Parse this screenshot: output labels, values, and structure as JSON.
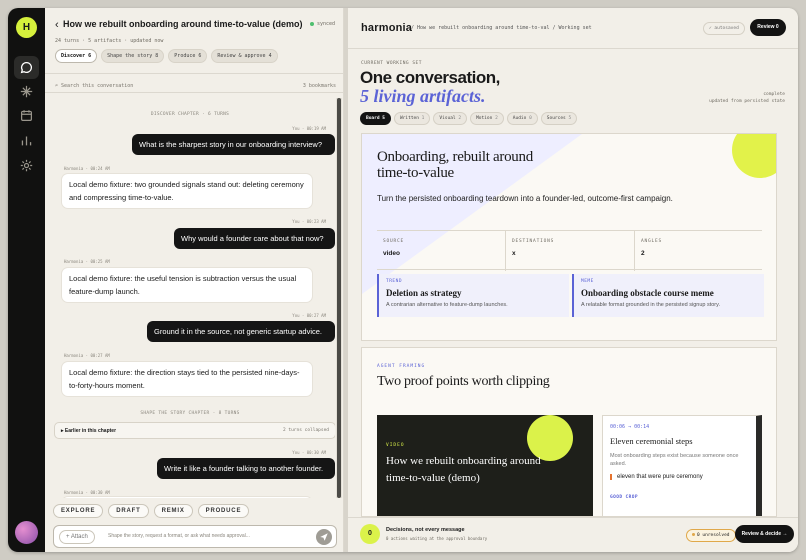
{
  "rail": {
    "logo": "H",
    "items": [
      "chat-icon",
      "sparkle-icon",
      "calendar-icon",
      "chart-icon",
      "gear-icon"
    ]
  },
  "chat": {
    "back": "‹",
    "title": "How we rebuilt onboarding around time-to-value (demo)",
    "synced": "synced",
    "meta": "24 turns · 5 artifacts · updated now",
    "chapters": [
      {
        "label": "Discover 6"
      },
      {
        "label": "Shape the story 8"
      },
      {
        "label": "Produce 6"
      },
      {
        "label": "Review & approve 4"
      }
    ],
    "search_placeholder": "Search this conversation",
    "bookmarks": "3 bookmarks",
    "divider1": "DISCOVER CHAPTER · 6 TURNS",
    "divider2": "SHAPE THE STORY CHAPTER · 8 TURNS",
    "messages": [
      {
        "role": "user",
        "stamp": "You · 00:19 AM",
        "text": "What is the sharpest story in our onboarding interview?"
      },
      {
        "role": "ai",
        "stamp": "Harmonia · 00:24 AM",
        "text": "Local demo fixture: two grounded signals stand out: deleting ceremony and compressing time-to-value."
      },
      {
        "role": "user",
        "stamp": "You · 00:23 AM",
        "text": "Why would a founder care about that now?"
      },
      {
        "role": "ai",
        "stamp": "Harmonia · 00:25 AM",
        "text": "Local demo fixture: the useful tension is subtraction versus the usual feature-dump launch."
      },
      {
        "role": "user",
        "stamp": "You · 00:27 AM",
        "text": "Ground it in the source, not generic startup advice."
      },
      {
        "role": "ai",
        "stamp": "Harmonia · 00:27 AM",
        "text": "Local demo fixture: the direction stays tied to the persisted nine-days-to-forty-hours moment."
      },
      {
        "role": "user",
        "stamp": "You · 00:30 AM",
        "text": "Write it like a founder talking to another founder."
      },
      {
        "role": "ai",
        "stamp": "Harmonia · 00:30 AM",
        "text": ""
      }
    ],
    "collapsed_label": "▸ Earlier in this chapter",
    "collapsed_count": "2 turns collapsed",
    "actions": [
      "EXPLORE",
      "DRAFT",
      "REMIX",
      "PRODUCE"
    ],
    "attach": "+ Attach",
    "composer_placeholder": "Shape the story, request a format, or ask what needs approval..."
  },
  "work": {
    "brand": "harmonia",
    "breadcrumb": "/ How we rebuilt onboarding around time-to-val / Working set",
    "autosaved": "✓ autosaved",
    "review_top": "Review 0",
    "label": "CURRENT WORKING SET",
    "heading1": "One conversation,",
    "heading2": "5 living artifacts.",
    "complete1": "complete",
    "complete2": "updated from persisted state",
    "tabs": [
      {
        "label": "Board",
        "n": "5"
      },
      {
        "label": "Written",
        "n": "1"
      },
      {
        "label": "Visual",
        "n": "2"
      },
      {
        "label": "Motion",
        "n": "2"
      },
      {
        "label": "Audio",
        "n": "0"
      },
      {
        "label": "Sources",
        "n": "5"
      }
    ],
    "card1": {
      "title": "Onboarding, rebuilt around time-to-value",
      "subtitle": "Turn the persisted onboarding teardown into a founder-led, outcome-first campaign.",
      "stats": [
        {
          "k": "SOURCE",
          "v": "video"
        },
        {
          "k": "DESTINATIONS",
          "v": "x"
        },
        {
          "k": "ANGLES",
          "v": "2"
        }
      ],
      "sub": [
        {
          "k": "TREND",
          "t": "Deletion as strategy",
          "d": "A contrarian alternative to feature-dump launches."
        },
        {
          "k": "MEME",
          "t": "Onboarding obstacle course meme",
          "d": "A relatable format grounded in the persisted signup story."
        }
      ]
    },
    "card2": {
      "label": "AGENT FRAMING",
      "title": "Two proof points worth clipping",
      "video_label": "VIDEO",
      "video_title": "How we rebuilt onboarding around time-to-value (demo)",
      "clip_time": "00:06 → 00:14",
      "clip_title": "Eleven ceremonial steps",
      "clip_sub": "Most onboarding steps exist because someone once asked.",
      "clip_quote": "eleven that were pure ceremony",
      "clip_tag": "GOOD CROP"
    },
    "footer": {
      "count": "0",
      "title": "Decisions, not every message",
      "subtitle": "0 actions waiting at the approval boundary",
      "unresolved": "0 unresolved",
      "decide": "Review & decide →"
    }
  }
}
